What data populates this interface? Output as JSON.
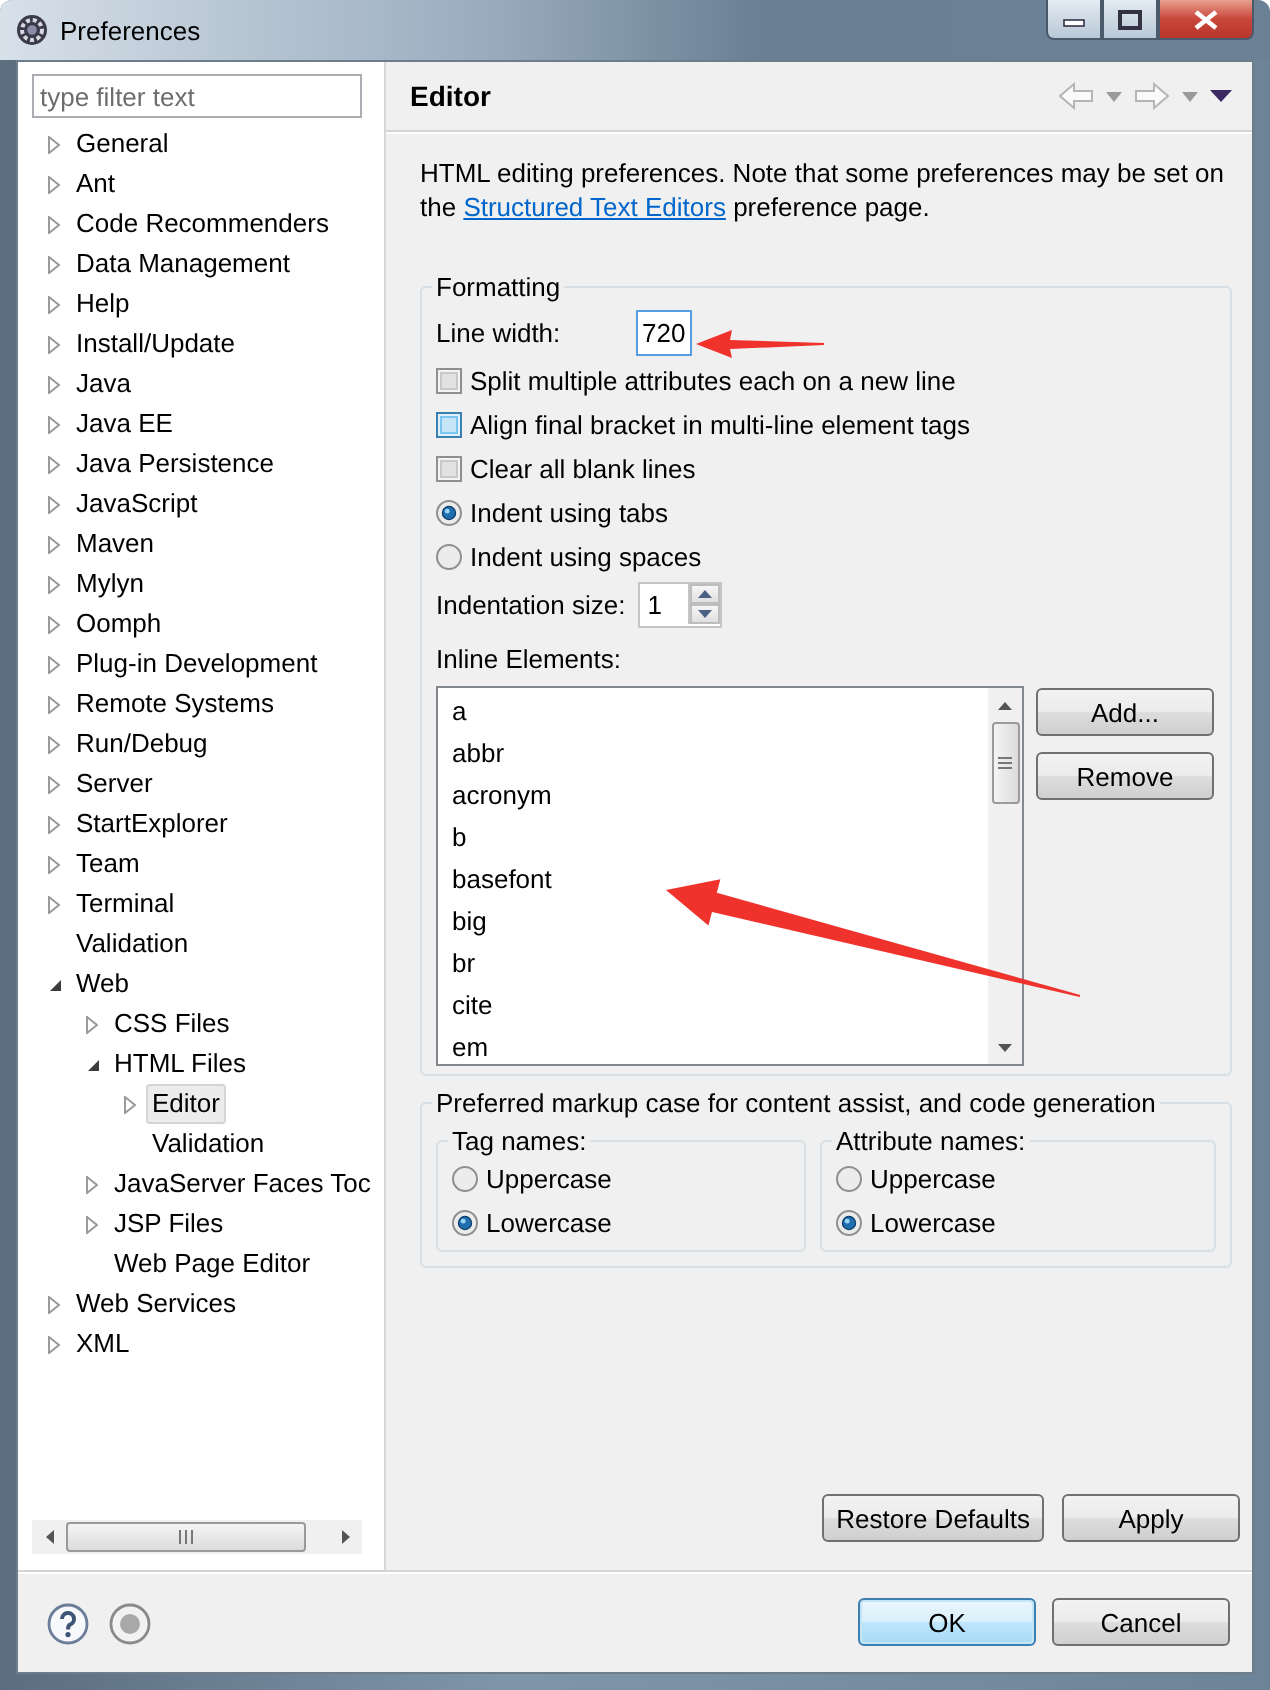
{
  "window": {
    "title": "Preferences"
  },
  "filter": {
    "placeholder": "type filter text"
  },
  "tree": [
    {
      "label": "General",
      "expanded": false,
      "selected": false
    },
    {
      "label": "Ant",
      "expanded": false,
      "selected": false
    },
    {
      "label": "Code Recommenders",
      "expanded": false,
      "selected": false
    },
    {
      "label": "Data Management",
      "expanded": false,
      "selected": false
    },
    {
      "label": "Help",
      "expanded": false,
      "selected": false
    },
    {
      "label": "Install/Update",
      "expanded": false,
      "selected": false
    },
    {
      "label": "Java",
      "expanded": false,
      "selected": false
    },
    {
      "label": "Java EE",
      "expanded": false,
      "selected": false
    },
    {
      "label": "Java Persistence",
      "expanded": false,
      "selected": false
    },
    {
      "label": "JavaScript",
      "expanded": false,
      "selected": false
    },
    {
      "label": "Maven",
      "expanded": false,
      "selected": false
    },
    {
      "label": "Mylyn",
      "expanded": false,
      "selected": false
    },
    {
      "label": "Oomph",
      "expanded": false,
      "selected": false
    },
    {
      "label": "Plug-in Development",
      "expanded": false,
      "selected": false
    },
    {
      "label": "Remote Systems",
      "expanded": false,
      "selected": false
    },
    {
      "label": "Run/Debug",
      "expanded": false,
      "selected": false
    },
    {
      "label": "Server",
      "expanded": false,
      "selected": false
    },
    {
      "label": "StartExplorer",
      "expanded": false,
      "selected": false
    },
    {
      "label": "Team",
      "expanded": false,
      "selected": false
    },
    {
      "label": "Terminal",
      "expanded": false,
      "selected": false
    },
    {
      "label": "Validation",
      "selected": false
    },
    {
      "label": "Web",
      "expanded": true,
      "selected": false,
      "children": [
        {
          "label": "CSS Files",
          "expanded": false,
          "selected": false
        },
        {
          "label": "HTML Files",
          "expanded": true,
          "selected": false,
          "children": [
            {
              "label": "Editor",
              "expanded": false,
              "selected": true
            },
            {
              "label": "Validation",
              "selected": false
            }
          ]
        },
        {
          "label": "JavaServer Faces Toc",
          "expanded": false,
          "selected": false
        },
        {
          "label": "JSP Files",
          "expanded": false,
          "selected": false
        },
        {
          "label": "Web Page Editor",
          "selected": false
        }
      ]
    },
    {
      "label": "Web Services",
      "expanded": false,
      "selected": false
    },
    {
      "label": "XML",
      "expanded": false,
      "selected": false
    }
  ],
  "page": {
    "title": "Editor",
    "description": {
      "text_before": "HTML editing preferences.  Note that some preferences may be set on the ",
      "link": "Structured Text Editors",
      "text_after": " preference page."
    }
  },
  "formatting": {
    "title": "Formatting",
    "line_width": {
      "label": "Line width:",
      "value": "720"
    },
    "options": [
      {
        "kind": "checkbox",
        "label": "Split multiple attributes each on a new line",
        "checked": false,
        "hovered": false
      },
      {
        "kind": "checkbox",
        "label": "Align final bracket in multi-line element tags",
        "checked": false,
        "hovered": true
      },
      {
        "kind": "checkbox",
        "label": "Clear all blank lines",
        "checked": false,
        "hovered": false
      },
      {
        "kind": "radio",
        "label": "Indent using tabs",
        "checked": true,
        "hovered": false
      },
      {
        "kind": "radio",
        "label": "Indent using spaces",
        "checked": false,
        "hovered": false
      }
    ],
    "indentation_size": {
      "label": "Indentation size:",
      "value": "1"
    },
    "inline_elements": {
      "label": "Inline Elements:",
      "items": [
        "a",
        "abbr",
        "acronym",
        "b",
        "basefont",
        "big",
        "br",
        "cite",
        "em"
      ],
      "buttons": [
        "Add...",
        "Remove"
      ]
    }
  },
  "markup_case": {
    "title": "Preferred markup case for content assist, and code generation",
    "groups": [
      {
        "title": "Tag names:",
        "options": [
          {
            "label": "Uppercase",
            "selected": false
          },
          {
            "label": "Lowercase",
            "selected": true
          }
        ]
      },
      {
        "title": "Attribute names:",
        "options": [
          {
            "label": "Uppercase",
            "selected": false
          },
          {
            "label": "Lowercase",
            "selected": true
          }
        ]
      }
    ]
  },
  "page_buttons": [
    "Restore Defaults",
    "Apply"
  ],
  "dialog_buttons": [
    {
      "label": "OK",
      "default": true
    },
    {
      "label": "Cancel",
      "default": false
    }
  ]
}
